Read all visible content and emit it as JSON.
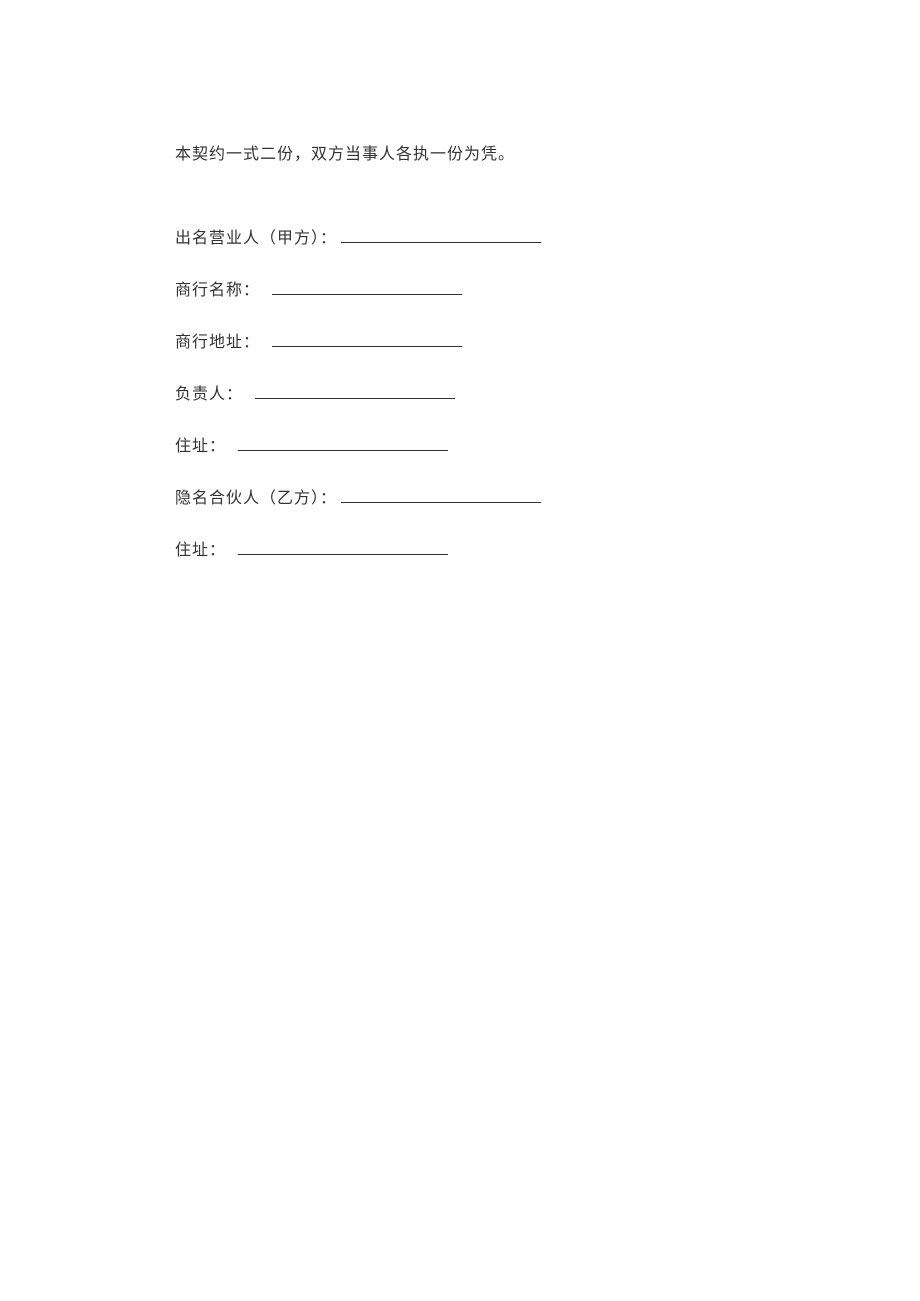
{
  "intro": "本契约一式二份，双方当事人各执一份为凭。",
  "fields": {
    "party_a_label": "出名营业人（甲方）：",
    "business_name_label": "商行名称：",
    "business_address_label": "商行地址：",
    "responsible_person_label": "负责人：",
    "address1_label": "住址：",
    "party_b_label": "隐名合伙人（乙方）：",
    "address2_label": "住址："
  }
}
